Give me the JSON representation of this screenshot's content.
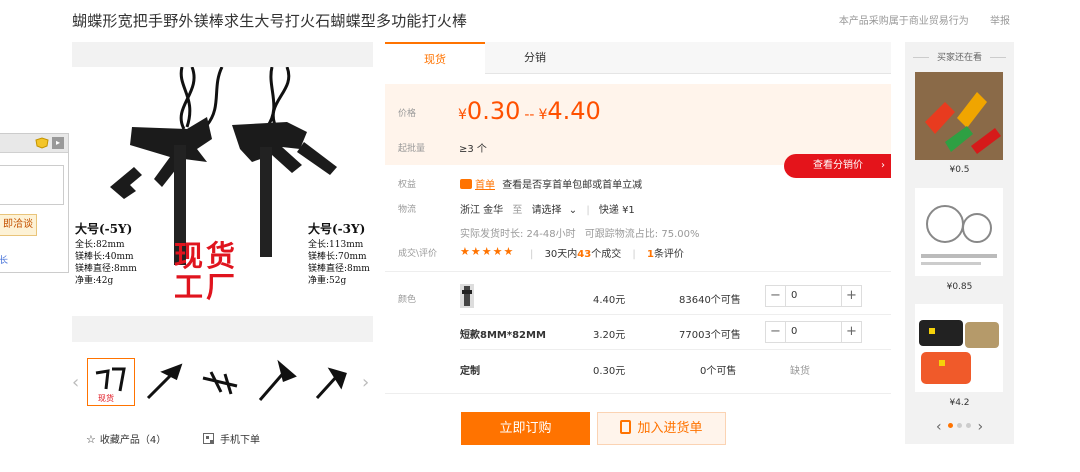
{
  "title": "蝴蝶形宽把手野外镁棒求生大号打火石蝴蝶型多功能打火棒",
  "top_links": {
    "commercial": "本产品采购属于商业贸易行为",
    "report": "举报"
  },
  "gallery": {
    "spec_left": {
      "head": "大号(-5Y)",
      "l1": "全长:82mm",
      "l2": "镁棒长:40mm",
      "l3": "镁棒直径:8mm",
      "l4": "净重:42g"
    },
    "spec_right": {
      "head": "大号(-3Y)",
      "l1": "全长:113mm",
      "l2": "镁棒长:70mm",
      "l3": "镁棒直径:8mm",
      "l4": "净重:52g"
    },
    "spot_line1": "现货",
    "spot_line2": "工厂",
    "prev_arrow": "‹",
    "next_arrow": "›"
  },
  "actions": {
    "favorite": "收藏产品（4）",
    "mobile": "手机下单"
  },
  "float_widget": {
    "consult": "即洽谈",
    "more": "长"
  },
  "tabs": [
    {
      "label": "现货"
    },
    {
      "label": "分销"
    }
  ],
  "price": {
    "label": "价格",
    "currency": "¥",
    "low": "0.30",
    "dash": "--",
    "high": "4.40",
    "moq_label": "起批量",
    "moq": "≥3 个",
    "dist_button": "查看分销价"
  },
  "rights": {
    "label": "权益",
    "badge": "首单",
    "text": "查看是否享首单包邮或首单立减"
  },
  "logistics": {
    "label": "物流",
    "from": "浙江 金华",
    "to": "至",
    "select": "请选择",
    "express": "快递 ¥1",
    "ship_time": "实际发货时长: 24-48小时",
    "dispute": "可跟踪物流占比: 75.00%"
  },
  "reviews": {
    "label": "成交\\评价",
    "stars": "★★★★★",
    "days_prefix": "30天内",
    "deals": "43",
    "deals_suffix": "个成交",
    "count": "1",
    "count_suffix": "条评价"
  },
  "sku": {
    "label": "颜色",
    "rows": [
      {
        "name": "",
        "price": "4.40元",
        "stock": "83640个可售",
        "qty": "0"
      },
      {
        "name": "短款8MM*82MM",
        "price": "3.20元",
        "stock": "77003个可售",
        "qty": "0"
      },
      {
        "name": "定制",
        "price": "0.30元",
        "stock": "0个可售",
        "status": "缺货"
      }
    ]
  },
  "buttons": {
    "buy": "立即订购",
    "cart": "加入进货单"
  },
  "recommend": {
    "title": "买家还在看",
    "items": [
      {
        "price": "¥0.5"
      },
      {
        "price": "¥0.85"
      },
      {
        "price": "¥4.2"
      }
    ],
    "prev": "‹",
    "next": "›"
  },
  "colors": {
    "accent": "#ff7300",
    "price": "#ff5000",
    "red": "#e4141b",
    "price_bg": "#fff4eb"
  }
}
